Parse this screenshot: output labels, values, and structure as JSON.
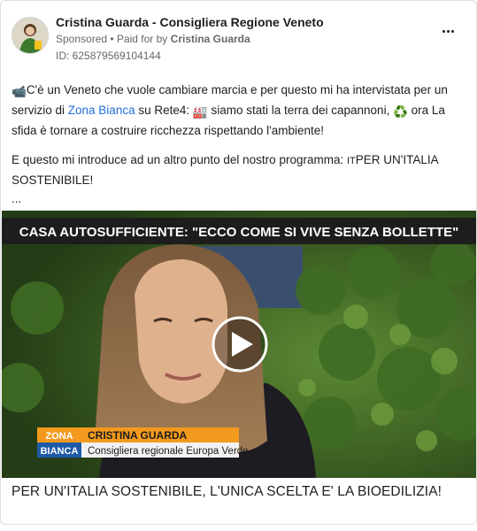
{
  "post": {
    "page_name": "Cristina Guarda - Consigliera Regione Veneto",
    "sponsored": "Sponsored",
    "separator": "•",
    "paid_for_by": "Paid for by",
    "payer": "Cristina Guarda",
    "ad_id": "ID: 625879569104144",
    "more_icon": "more-horizontal-icon"
  },
  "text": {
    "line1_emoji": "📹",
    "line1_a": "C'è un Veneto che vuole cambiare marcia e per questo mi ha intervistata per un servizio di ",
    "link": "Zona Bianca",
    "line1_b": " su Rete4: ",
    "factory_emoji": "🏭",
    "line1_c": " siamo stati la terra dei capannoni, ",
    "recycle_emoji": "♻️",
    "line1_d": " ora La sfida è tornare a costruire ricchezza rispettando l'ambiente!",
    "line2": "E questo mi introduce ad un altro punto del nostro programma: ",
    "flag": "IT",
    "line2_b": "PER UN'ITALIA SOSTENIBILE!",
    "ellipsis": "..."
  },
  "video": {
    "banner": "CASA AUTOSUFFICIENTE: \"ECCO COME SI VIVE SENZA BOLLETTE\"",
    "logo_line1": "ZONA",
    "logo_line2": "BIANCA",
    "lower_third_name": "CRISTINA GUARDA",
    "lower_third_role": "Consigliera regionale Europa Verde",
    "play_icon": "play-icon"
  },
  "caption": "PER UN'ITALIA SOSTENIBILE, L'UNICA SCELTA E' LA BIOEDILIZIA!",
  "colors": {
    "link": "#216fdb",
    "banner_bg": "#1d1d1d",
    "logo_orange": "#f39a1e",
    "lower_third_bg": "#f2f2f2"
  }
}
